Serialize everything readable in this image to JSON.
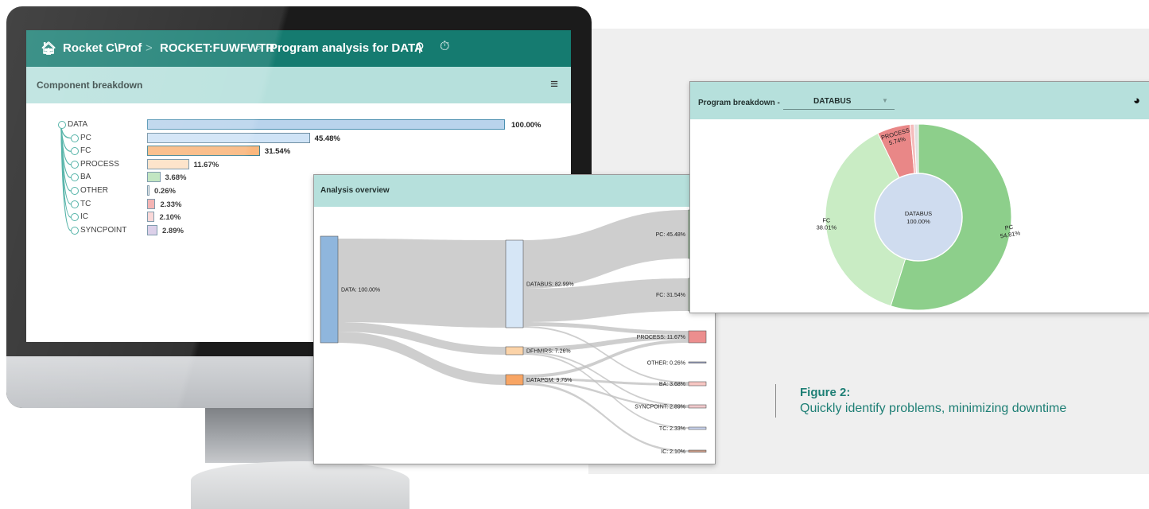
{
  "app": {
    "breadcrumb": [
      "Rocket C\\Prof",
      "ROCKET:FUWFWTR",
      "Program analysis for DATA"
    ],
    "icons": [
      "home-icon",
      "search-icon",
      "timer-icon"
    ]
  },
  "component_breakdown": {
    "title": "Component breakdown",
    "root": {
      "label": "DATA",
      "value_label": "100.00%"
    },
    "items": [
      {
        "label": "PC",
        "value_label": "45.48%"
      },
      {
        "label": "FC",
        "value_label": "31.54%"
      },
      {
        "label": "PROCESS",
        "value_label": "11.67%"
      },
      {
        "label": "BA",
        "value_label": "3.68%"
      },
      {
        "label": "OTHER",
        "value_label": "0.26%"
      },
      {
        "label": "TC",
        "value_label": "2.33%"
      },
      {
        "label": "IC",
        "value_label": "2.10%"
      },
      {
        "label": "SYNCPOINT",
        "value_label": "2.89%"
      }
    ],
    "colors": [
      "#b9d3ec",
      "#cfe3f6",
      "#fab77e",
      "#fde0c4",
      "#b9e2b9",
      "#e6e6e6",
      "#f3a9a9",
      "#f9d3d3",
      "#d7c9e6"
    ]
  },
  "chart_data": [
    {
      "type": "bar",
      "categories": [
        "DATA",
        "PC",
        "FC",
        "PROCESS",
        "BA",
        "OTHER",
        "TC",
        "IC",
        "SYNCPOINT"
      ],
      "values": [
        100.0,
        45.48,
        31.54,
        11.67,
        3.68,
        0.26,
        2.33,
        2.1,
        2.89
      ],
      "title": "Component breakdown"
    },
    {
      "type": "sankey",
      "title": "Analysis overview",
      "nodes": [
        {
          "name": "DATA",
          "label": "DATA: 100.00%",
          "color": "#8fb6dd"
        },
        {
          "name": "DATABUS",
          "label": "DATABUS: 82.99%",
          "color": "#d6e6f6"
        },
        {
          "name": "DFHMIRS",
          "label": "DFHMIRS: 7.26%",
          "color": "#fbd3a8"
        },
        {
          "name": "DATAPGM",
          "label": "DATAPGM: 9.75%",
          "color": "#f8a564"
        },
        {
          "name": "PC",
          "label": "PC: 45.48%",
          "color": "#8ccf8c"
        },
        {
          "name": "FC",
          "label": "FC: 31.54%",
          "color": "#c9ecc4"
        },
        {
          "name": "PROCESS",
          "label": "PROCESS: 11.67%",
          "color": "#ec8e8e"
        },
        {
          "name": "OTHER",
          "label": "OTHER: 0.26%",
          "color": "#9aa4c8"
        },
        {
          "name": "BA",
          "label": "BA: 3.68%",
          "color": "#f6c6c2"
        },
        {
          "name": "SYNCPOINT",
          "label": "SYNCPOINT: 2.89%",
          "color": "#f0c9cc"
        },
        {
          "name": "TC",
          "label": "TC: 2.33%",
          "color": "#c9d3ee"
        },
        {
          "name": "IC",
          "label": "IC: 2.10%",
          "color": "#c99a86"
        }
      ]
    },
    {
      "type": "pie",
      "title": "Program breakdown -",
      "selected": "DATABUS",
      "center_label": "DATABUS",
      "center_value": "100.00%",
      "slices": [
        {
          "label": "PC",
          "value": 54.81,
          "value_label": "54.81%",
          "color": "#8dcf8b"
        },
        {
          "label": "FC",
          "value": 38.01,
          "value_label": "38.01%",
          "color": "#c9ecc4"
        },
        {
          "label": "PROCESS",
          "value": 5.74,
          "value_label": "5.74%",
          "color": "#e98787"
        },
        {
          "label": "",
          "value": 0.72,
          "value_label": "",
          "color": "#f5bcbc"
        },
        {
          "label": "",
          "value": 0.72,
          "value_label": "",
          "color": "#e0e0e0"
        }
      ]
    }
  ],
  "overview": {
    "title": "Analysis overview"
  },
  "program": {
    "title": "Program breakdown -",
    "selected": "DATABUS"
  },
  "caption": {
    "title": "Figure 2:",
    "text": "Quickly identify problems, minimizing downtime"
  }
}
